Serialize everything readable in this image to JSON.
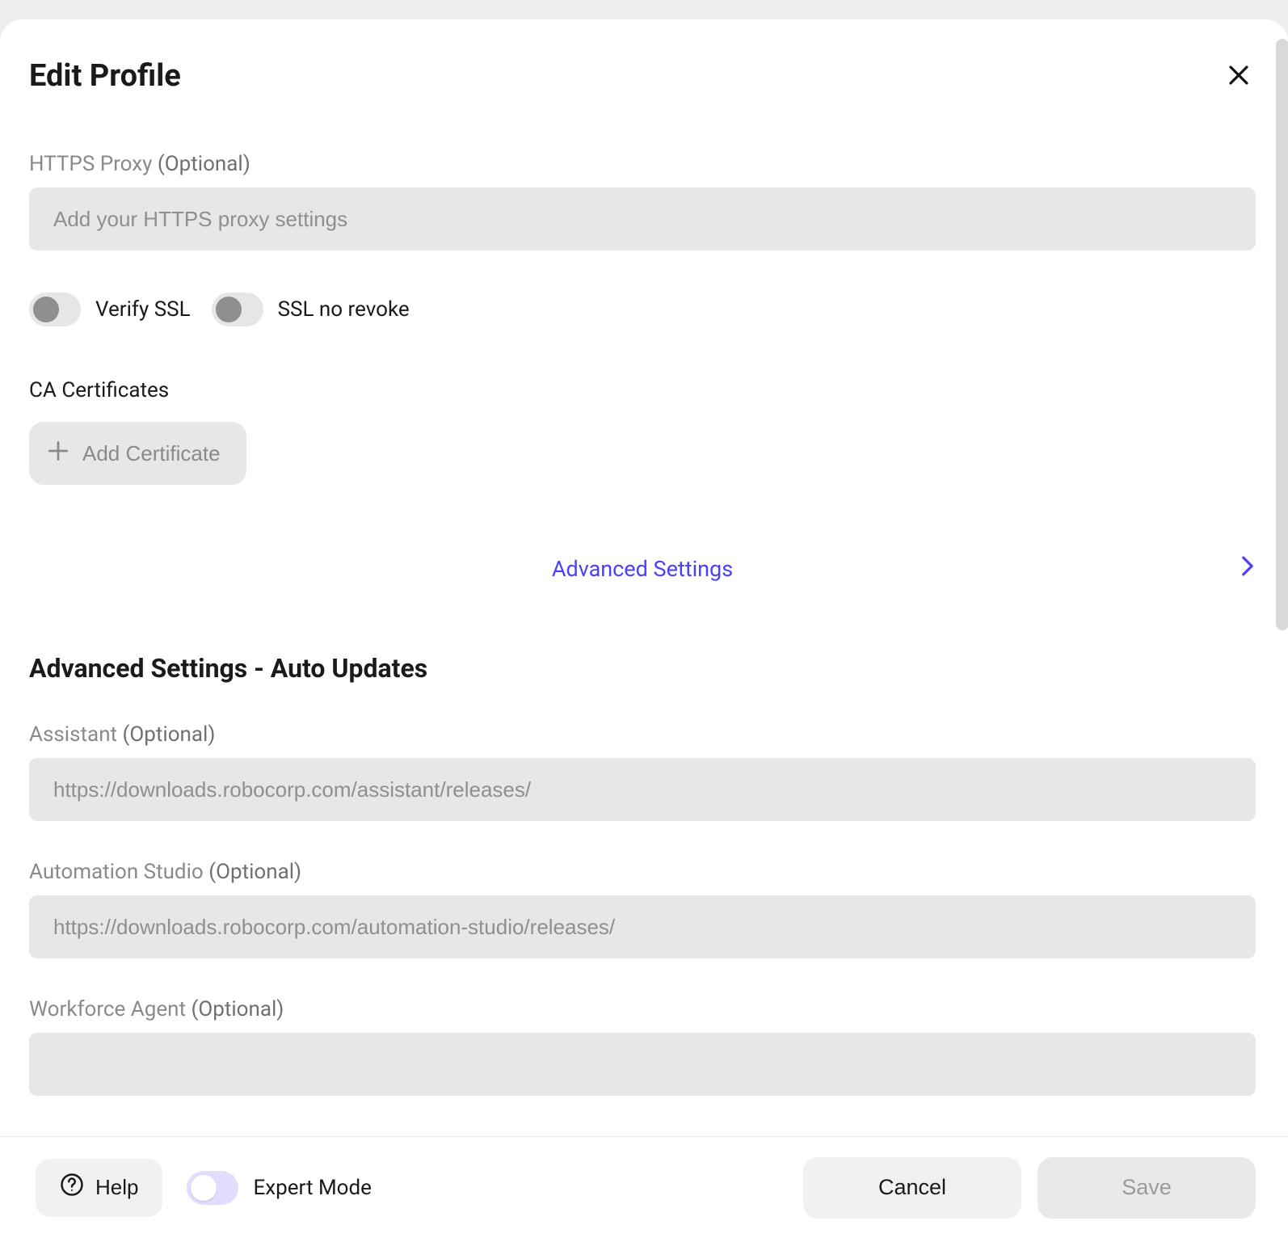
{
  "header": {
    "title": "Edit Profile"
  },
  "https_proxy": {
    "label": "HTTPS Proxy",
    "optional": "(Optional)",
    "placeholder": "Add your HTTPS proxy settings",
    "value": ""
  },
  "toggles": {
    "verify_ssl": {
      "label": "Verify SSL",
      "on": false
    },
    "ssl_no_revoke": {
      "label": "SSL no revoke",
      "on": false
    }
  },
  "ca": {
    "heading": "CA Certificates",
    "add_button": "Add Certificate"
  },
  "advanced_link": "Advanced Settings",
  "auto_updates": {
    "section_title": "Advanced Settings - Auto Updates",
    "assistant": {
      "label": "Assistant",
      "optional": "(Optional)",
      "placeholder": "https://downloads.robocorp.com/assistant/releases/",
      "value": ""
    },
    "automation_studio": {
      "label": "Automation Studio",
      "optional": "(Optional)",
      "placeholder": "https://downloads.robocorp.com/automation-studio/releases/",
      "value": ""
    },
    "workforce_agent": {
      "label": "Workforce Agent",
      "optional": "(Optional)",
      "placeholder": "",
      "value": ""
    }
  },
  "footer": {
    "help": "Help",
    "expert_mode": {
      "label": "Expert Mode",
      "on": false
    },
    "cancel": "Cancel",
    "save": "Save"
  }
}
